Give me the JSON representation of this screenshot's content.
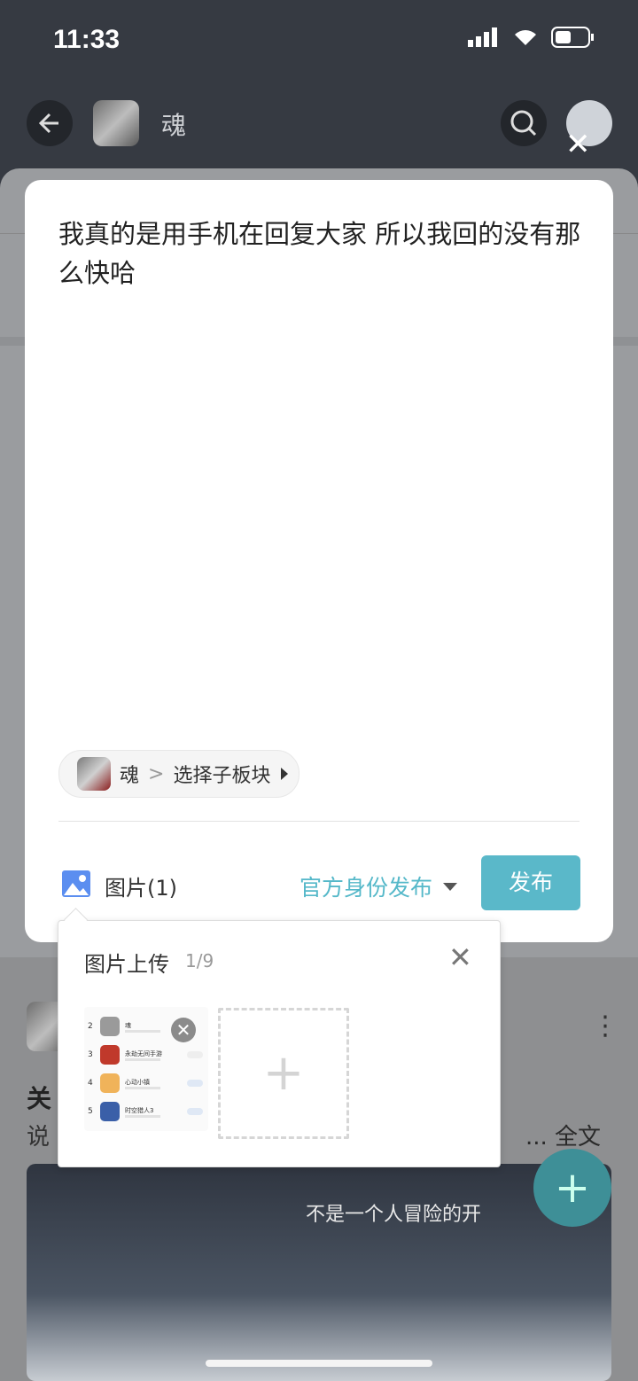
{
  "status_bar": {
    "time": "11:33"
  },
  "header": {
    "title": "魂"
  },
  "modal": {
    "message": "我真的是用手机在回复大家 所以我回的没有那么快哈",
    "board": {
      "name": "魂",
      "sub_board": "选择子板块"
    },
    "image_label": "图片(1)",
    "identity": "官方身份发布",
    "publish": "发布"
  },
  "upload_popup": {
    "title": "图片上传",
    "count": "1/9",
    "thumbnail_rows": [
      {
        "num": "2",
        "name": "魂"
      },
      {
        "num": "3",
        "name": "永劫无间手游"
      },
      {
        "num": "4",
        "name": "心动小镇"
      },
      {
        "num": "5",
        "name": "时空猎人3"
      }
    ]
  },
  "feed": {
    "title": "关",
    "text": "说",
    "full_text": "... 全文",
    "banner_text": "不是一个人冒险的开"
  },
  "colors": {
    "accent": "#5ab8c9",
    "header": "#363a42"
  }
}
